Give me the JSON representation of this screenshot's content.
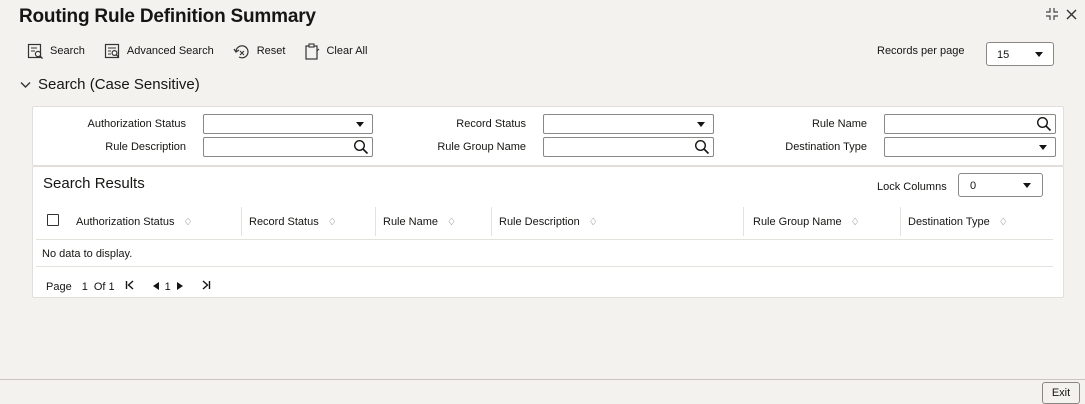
{
  "window": {
    "title": "Routing Rule Definition Summary"
  },
  "toolbar": {
    "search_label": "Search",
    "advanced_search_label": "Advanced Search",
    "reset_label": "Reset",
    "clear_all_label": "Clear All"
  },
  "records_per_page": {
    "label": "Records per page",
    "value": "15"
  },
  "search_section": {
    "title": "Search (Case Sensitive)"
  },
  "search_form": {
    "authorization_status": {
      "label": "Authorization Status",
      "value": ""
    },
    "record_status": {
      "label": "Record Status",
      "value": ""
    },
    "rule_name": {
      "label": "Rule Name",
      "value": ""
    },
    "rule_description": {
      "label": "Rule Description",
      "value": ""
    },
    "rule_group_name": {
      "label": "Rule Group Name",
      "value": ""
    },
    "destination_type": {
      "label": "Destination Type",
      "value": ""
    }
  },
  "results": {
    "title": "Search Results",
    "lock_columns_label": "Lock Columns",
    "lock_columns_value": "0",
    "columns": [
      "Authorization Status",
      "Record Status",
      "Rule Name",
      "Rule Description",
      "Rule Group Name",
      "Destination Type"
    ],
    "sort_glyph": "♢",
    "empty_message": "No data to display."
  },
  "pager": {
    "page_label": "Page",
    "page_value": "1",
    "of_label": "Of 1",
    "current": "1"
  },
  "footer": {
    "exit_label": "Exit"
  }
}
